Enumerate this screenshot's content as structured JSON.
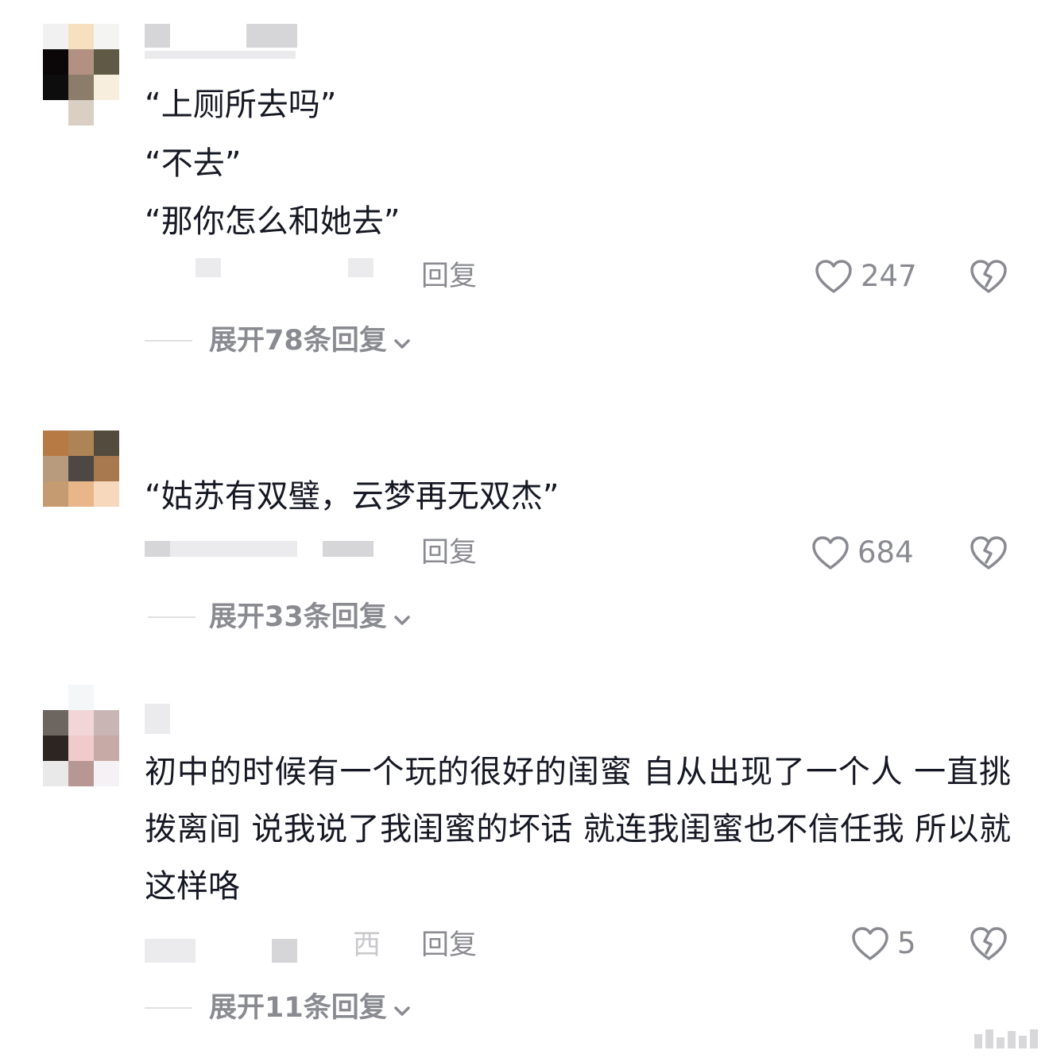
{
  "comments": [
    {
      "text_lines": [
        "“上厕所去吗”",
        "“不去”",
        "“那你怎么和她去”"
      ],
      "reply_label": "回复",
      "like_count": "247",
      "expand_label": "展开78条回复"
    },
    {
      "text_lines": [
        "“姑苏有双璧，云梦再无双杰”"
      ],
      "reply_label": "回复",
      "like_count": "684",
      "expand_label": "展开33条回复"
    },
    {
      "text": "初中的时候有一个玩的很好的闺蜜 自从出现了一个人 一直挑拨离间 说我说了我闺蜜的坏话 就连我闺蜜也不信任我 所以就这样咯",
      "location_fragment": "西",
      "reply_label": "回复",
      "like_count": "5",
      "expand_label": "展开11条回复"
    }
  ],
  "icons": {
    "like": "heart-outline-icon",
    "dislike": "broken-heart-icon",
    "expand": "chevron-down-icon"
  },
  "colors": {
    "text": "#161823",
    "secondary": "#8a8b91"
  }
}
